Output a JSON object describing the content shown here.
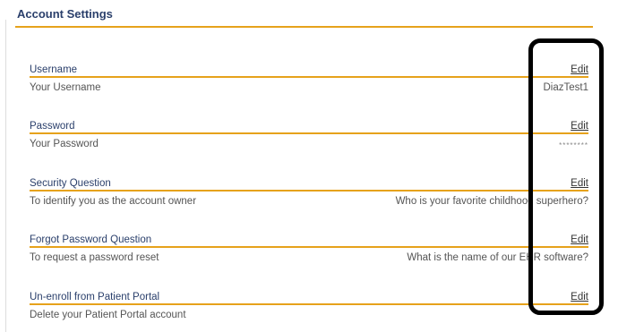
{
  "page": {
    "title": "Account Settings"
  },
  "sections": [
    {
      "label": "Username",
      "edit_label": "Edit",
      "description": "Your Username",
      "value": "DiazTest1"
    },
    {
      "label": "Password",
      "edit_label": "Edit",
      "description": "Your Password",
      "value": "********"
    },
    {
      "label": "Security Question",
      "edit_label": "Edit",
      "description": "To identify you as the account owner",
      "value": "Who is your favorite childhood superhero?"
    },
    {
      "label": "Forgot Password Question",
      "edit_label": "Edit",
      "description": "To request a password reset",
      "value": "What is the name of our EHR software?"
    },
    {
      "label": "Un-enroll from Patient Portal",
      "edit_label": "Edit",
      "description": "Delete your Patient Portal account",
      "value": ""
    }
  ],
  "colors": {
    "accent": "#e6a21b",
    "heading": "#2a3f6b",
    "highlight": "#000000"
  }
}
